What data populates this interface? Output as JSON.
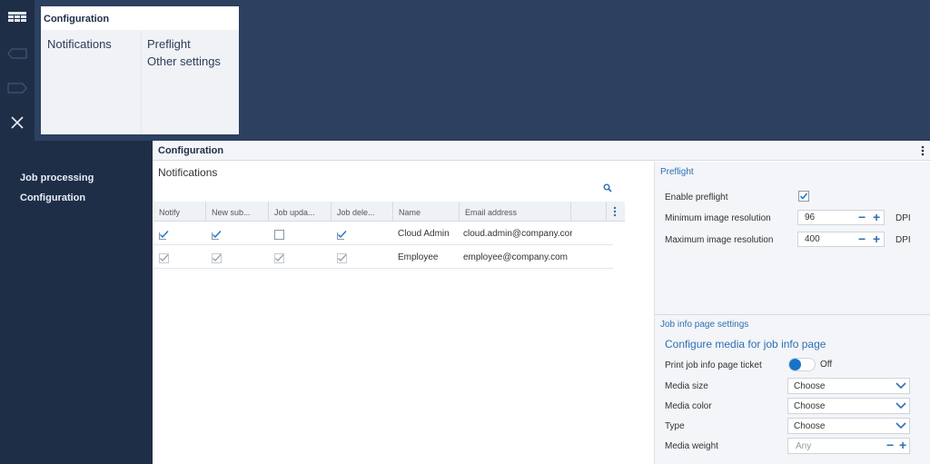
{
  "menu": {
    "title": "Configuration",
    "col1": [
      "Notifications"
    ],
    "col2": [
      "Preflight",
      "Other settings"
    ]
  },
  "sidebar": {
    "items": [
      {
        "label": "Job processing"
      },
      {
        "label": "Configuration"
      }
    ]
  },
  "main": {
    "title": "Configuration",
    "notifications": {
      "title": "Notifications",
      "columns": [
        "Notify",
        "New sub...",
        "Job upda...",
        "Job dele...",
        "Name",
        "Email address"
      ],
      "rows": [
        {
          "notify": true,
          "new_sub": true,
          "job_update": false,
          "job_delete": true,
          "enabled": true,
          "name": "Cloud Admin",
          "email": "cloud.admin@company.cor"
        },
        {
          "notify": true,
          "new_sub": true,
          "job_update": true,
          "job_delete": true,
          "enabled": false,
          "name": "Employee",
          "email": "employee@company.com"
        }
      ]
    },
    "preflight": {
      "title": "Preflight",
      "enable_label": "Enable preflight",
      "enabled": true,
      "min_label": "Minimum image resolution",
      "min_value": "96",
      "max_label": "Maximum image resolution",
      "max_value": "400",
      "unit": "DPI"
    },
    "jobinfo": {
      "title": "Job info page settings",
      "link": "Configure media for job info page",
      "print_label": "Print job info page ticket",
      "print_state": "Off",
      "media_size_label": "Media size",
      "media_size_value": "Choose",
      "media_color_label": "Media color",
      "media_color_value": "Choose",
      "type_label": "Type",
      "type_value": "Choose",
      "weight_label": "Media weight",
      "weight_placeholder": "Any"
    }
  },
  "colors": {
    "accent": "#1a73c8",
    "link": "#2f6fb3",
    "dark_bg": "#1e2e47",
    "header_bg": "#2c4060"
  },
  "icons": {
    "rail": [
      "menu-grid-icon",
      "tag-left-icon",
      "tag-right-icon",
      "close-icon"
    ],
    "search": "search-icon",
    "more": "kebab-icon"
  }
}
